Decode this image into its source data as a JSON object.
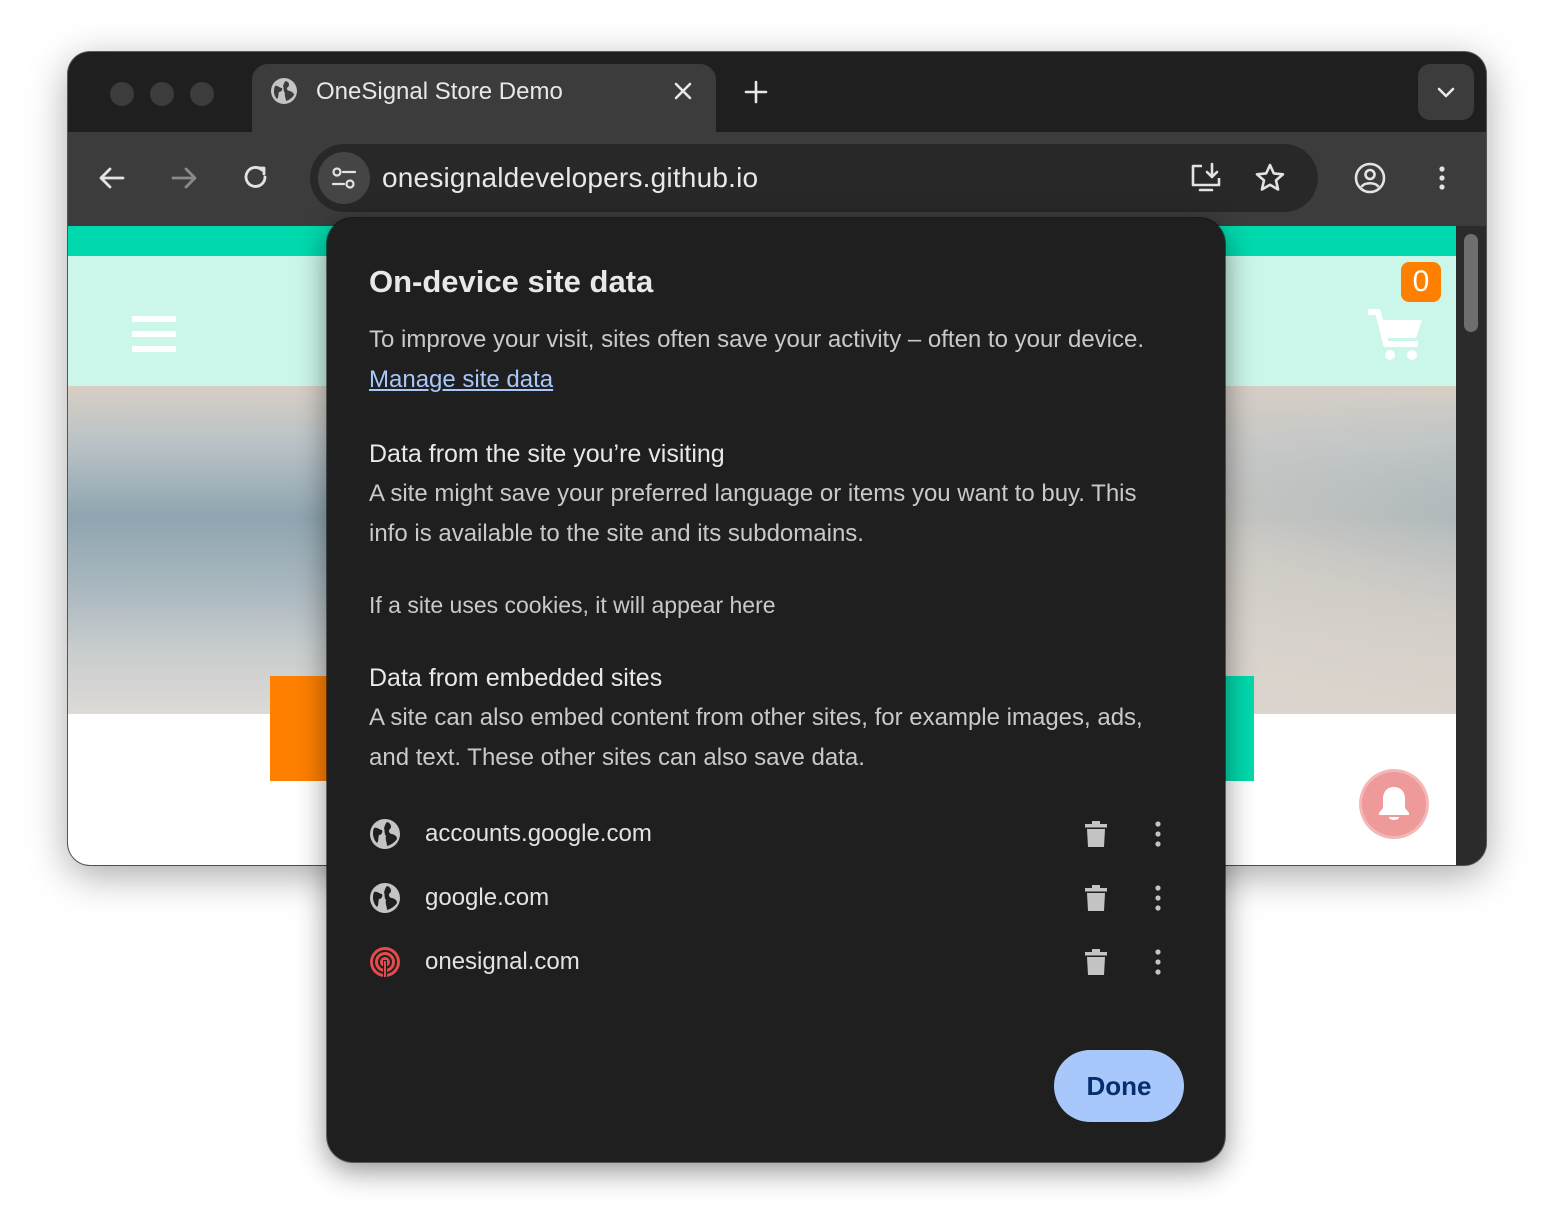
{
  "browser": {
    "tab_title": "OneSignal Store Demo",
    "url": "onesignaldevelopers.github.io"
  },
  "page": {
    "cart_count": "0",
    "colors": {
      "teal": "#00d9ad",
      "mint": "#cbf6ea",
      "orange": "#ff8000",
      "bell": "#ef9a9a"
    }
  },
  "popup": {
    "title": "On-device site data",
    "intro_text": "To improve your visit, sites often save your activity – often to your device.",
    "manage_link": "Manage site data",
    "section1_heading": "Data from the site you’re visiting",
    "section1_text": "A site might save your preferred language or items you want to buy. This info is available to the site and its subdomains.",
    "cookies_note": "If a site uses cookies, it will appear here",
    "section2_heading": "Data from embedded sites",
    "section2_text": "A site can also embed content from other sites, for example images, ads, and text. These other sites can also save data.",
    "sites": [
      {
        "name": "accounts.google.com",
        "icon": "globe-icon"
      },
      {
        "name": "google.com",
        "icon": "globe-icon"
      },
      {
        "name": "onesignal.com",
        "icon": "onesignal-icon"
      }
    ],
    "done_label": "Done",
    "accent_color": "#a8c7fa"
  }
}
